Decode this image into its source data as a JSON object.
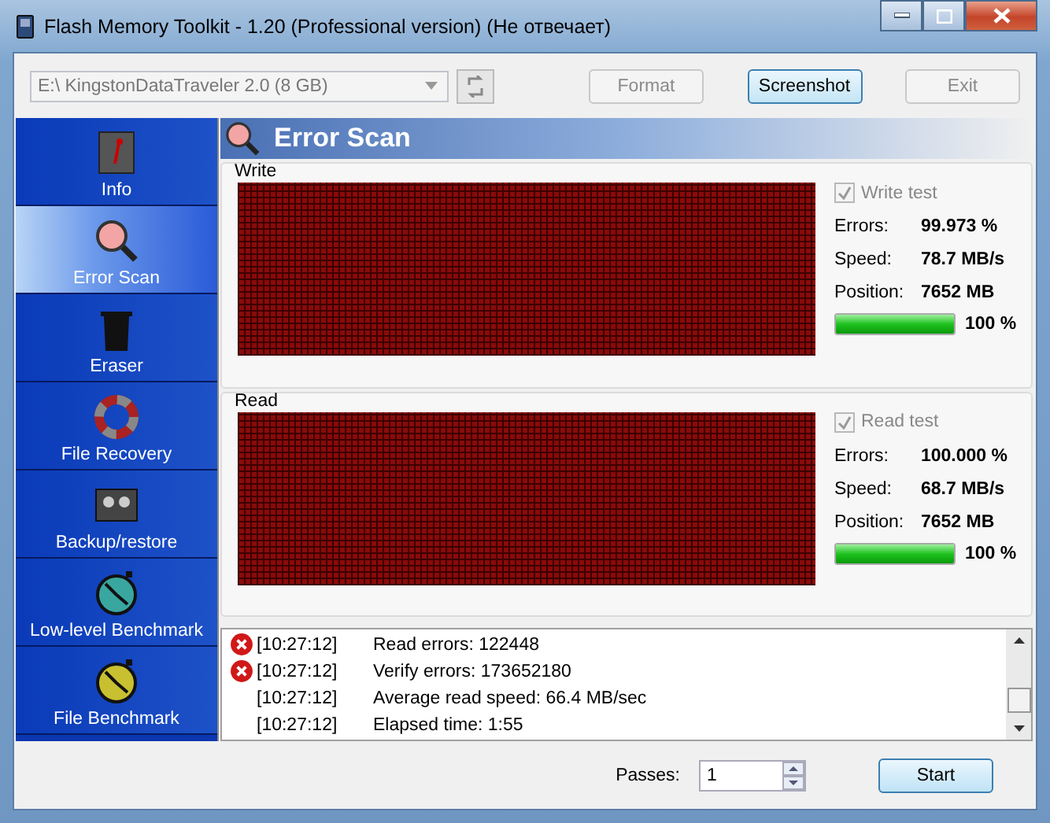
{
  "window": {
    "title": "Flash Memory Toolkit - 1.20 (Professional version) (Не отвечает)"
  },
  "toolbar": {
    "drive": "E:\\ KingstonDataTraveler 2.0 (8 GB)",
    "buttons": [
      {
        "label": "Format",
        "disabled": true
      },
      {
        "label": "Screenshot",
        "disabled": false
      },
      {
        "label": "Exit",
        "disabled": true
      }
    ]
  },
  "sidebar": {
    "items": [
      {
        "label": "Info",
        "kind": "info",
        "selected": false
      },
      {
        "label": "Error Scan",
        "kind": "scan",
        "selected": true
      },
      {
        "label": "Eraser",
        "kind": "eraser",
        "selected": false
      },
      {
        "label": "File Recovery",
        "kind": "recovery",
        "selected": false
      },
      {
        "label": "Backup/restore",
        "kind": "backup",
        "selected": false
      },
      {
        "label": "Low-level Benchmark",
        "kind": "benchmark",
        "selected": false
      },
      {
        "label": "File Benchmark",
        "kind": "filebench",
        "selected": false
      }
    ]
  },
  "header": {
    "title": "Error Scan"
  },
  "groups": [
    {
      "title": "Write",
      "checkbox": "Write test",
      "checked": true,
      "stats": [
        {
          "label": "Errors:",
          "value": "99.973 %"
        },
        {
          "label": "Speed:",
          "value": "78.7 MB/s"
        },
        {
          "label": "Position:",
          "value": "7652 MB"
        }
      ],
      "level": 1,
      "percent": "100 %"
    },
    {
      "title": "Read",
      "checkbox": "Read test",
      "checked": true,
      "stats": [
        {
          "label": "Errors:",
          "value": "100.000 %"
        },
        {
          "label": "Speed:",
          "value": "68.7 MB/s"
        },
        {
          "label": "Position:",
          "value": "7652 MB"
        }
      ],
      "level": 1,
      "percent": "100 %"
    }
  ],
  "log": [
    {
      "kind": "error",
      "time": "[10:27:12]",
      "message": "Read errors: 122448"
    },
    {
      "kind": "error",
      "time": "[10:27:12]",
      "message": "Verify errors: 173652180"
    },
    {
      "kind": "info",
      "time": "[10:27:12]",
      "message": "Average read speed: 66.4 MB/sec"
    },
    {
      "kind": "info",
      "time": "[10:27:12]",
      "message": "Elapsed time: 1:55"
    }
  ],
  "passes": {
    "label": "Passes:",
    "value": "1"
  },
  "start_button": "Start"
}
